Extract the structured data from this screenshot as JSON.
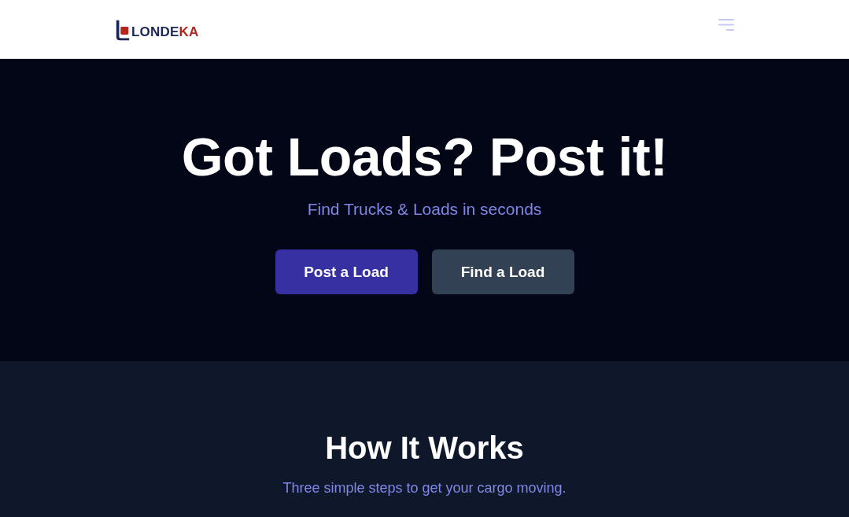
{
  "header": {
    "logo": {
      "parts": [
        {
          "text": "LONDE",
          "color": "#1b2654"
        },
        {
          "text": "KA",
          "color": "#b3261e"
        }
      ]
    }
  },
  "hero": {
    "title": "Got Loads? Post it!",
    "subtitle": "Find Trucks & Loads in seconds",
    "buttons": [
      {
        "label": "Post a Load",
        "kind": "primary"
      },
      {
        "label": "Find a Load",
        "kind": "secondary"
      }
    ]
  },
  "how_it_works": {
    "title": "How It Works",
    "subtitle": "Three simple steps to get your cargo moving."
  }
}
